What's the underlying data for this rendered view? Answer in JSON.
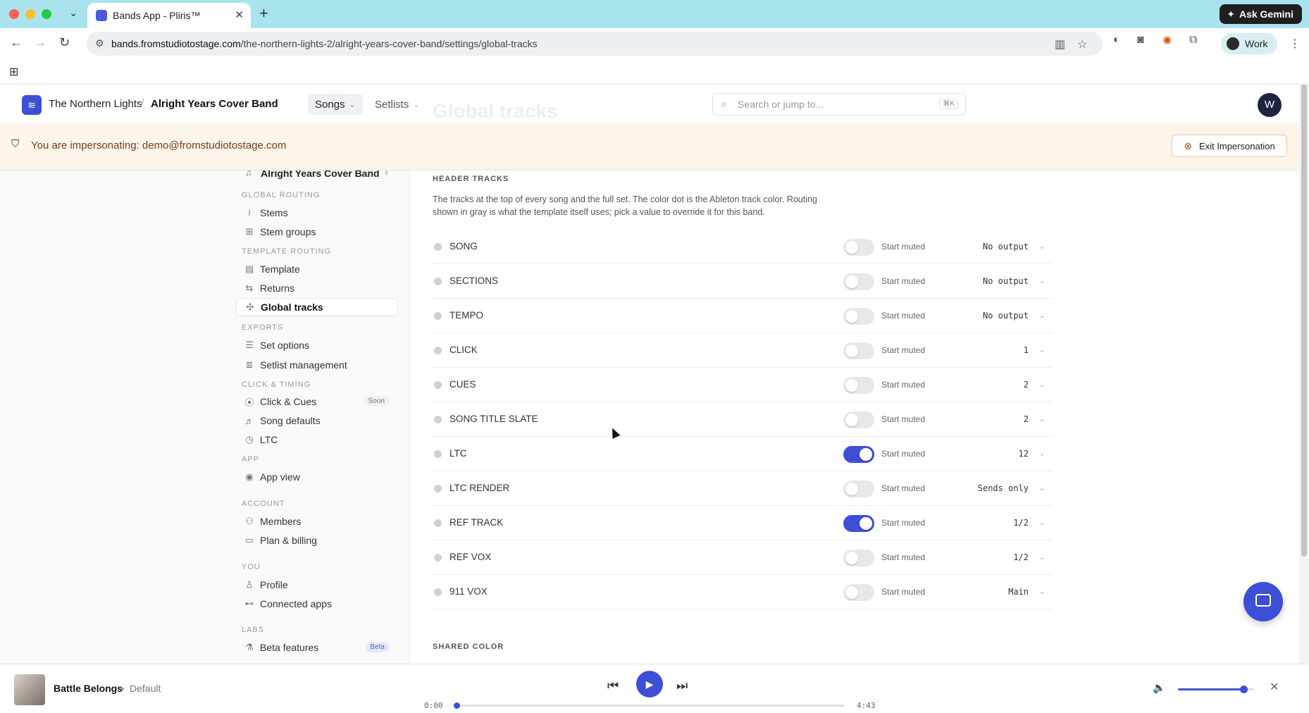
{
  "browser": {
    "tab_title": "Bands App - Pliris™",
    "url_host": "bands.fromstudiotostage.com",
    "url_path": "/the-northern-lights-2/alright-years-cover-band/settings/global-tracks",
    "ask_gemini_label": "Ask Gemini",
    "profile_label": "Work"
  },
  "header": {
    "org_name": "The Northern Lights",
    "band_name": "Alright Years Cover Band",
    "nav_songs": "Songs",
    "nav_setlists": "Setlists",
    "ghost_title": "Global tracks",
    "search_placeholder": "Search or jump to...",
    "search_shortcut": "⌘K",
    "avatar_initial": "W"
  },
  "banner": {
    "text": "You are impersonating: demo@fromstudiotostage.com",
    "exit_label": "Exit Impersonation"
  },
  "sidebar": {
    "band_switcher": "Alright Years Cover Band",
    "sections": [
      {
        "title": "GLOBAL ROUTING"
      },
      {
        "title": "TEMPLATE ROUTING"
      },
      {
        "title": "EXPORTS"
      },
      {
        "title": "CLICK & TIMING"
      },
      {
        "title": "APP"
      },
      {
        "title": "ACCOUNT"
      },
      {
        "title": "YOU"
      },
      {
        "title": "LABS"
      }
    ],
    "items": [
      {
        "label": "Stems"
      },
      {
        "label": "Stem groups"
      },
      {
        "label": "Template"
      },
      {
        "label": "Returns"
      },
      {
        "label": "Global tracks"
      },
      {
        "label": "Set options"
      },
      {
        "label": "Setlist management"
      },
      {
        "label": "Click & Cues",
        "badge": "Soon"
      },
      {
        "label": "Song defaults"
      },
      {
        "label": "LTC"
      },
      {
        "label": "App view"
      },
      {
        "label": "Members"
      },
      {
        "label": "Plan & billing"
      },
      {
        "label": "Profile"
      },
      {
        "label": "Connected apps"
      },
      {
        "label": "Beta features",
        "badge": "Beta"
      }
    ]
  },
  "main": {
    "section_title": "HEADER TRACKS",
    "section_desc": "The tracks at the top of every song and the full set. The color dot is the Ableton track color. Routing shown in gray is what the template itself uses; pick a value to override it for this band.",
    "muted_label": "Start muted",
    "tracks": [
      {
        "name": "SONG",
        "muted": false,
        "output": "No output"
      },
      {
        "name": "SECTIONS",
        "muted": false,
        "output": "No output"
      },
      {
        "name": "TEMPO",
        "muted": false,
        "output": "No output"
      },
      {
        "name": "CLICK",
        "muted": false,
        "output": "1"
      },
      {
        "name": "CUES",
        "muted": false,
        "output": "2"
      },
      {
        "name": "SONG TITLE SLATE",
        "muted": false,
        "output": "2"
      },
      {
        "name": "LTC",
        "muted": true,
        "output": "12"
      },
      {
        "name": "LTC RENDER",
        "muted": false,
        "output": "Sends only"
      },
      {
        "name": "REF TRACK",
        "muted": true,
        "output": "1/2"
      },
      {
        "name": "REF VOX",
        "muted": false,
        "output": "1/2"
      },
      {
        "name": "911 VOX",
        "muted": false,
        "output": "Main"
      }
    ],
    "shared_title": "SHARED COLOR"
  },
  "player": {
    "song_title": "Battle Belongs",
    "song_sep": "•",
    "song_version": "Default",
    "time_current": "0:00",
    "time_total": "4:43",
    "progress": 0.0,
    "volume": 0.86
  },
  "colors": {
    "accent": "#3d4fd6",
    "banner_bg": "#fdf4ea",
    "banner_text": "#7a3e14"
  }
}
